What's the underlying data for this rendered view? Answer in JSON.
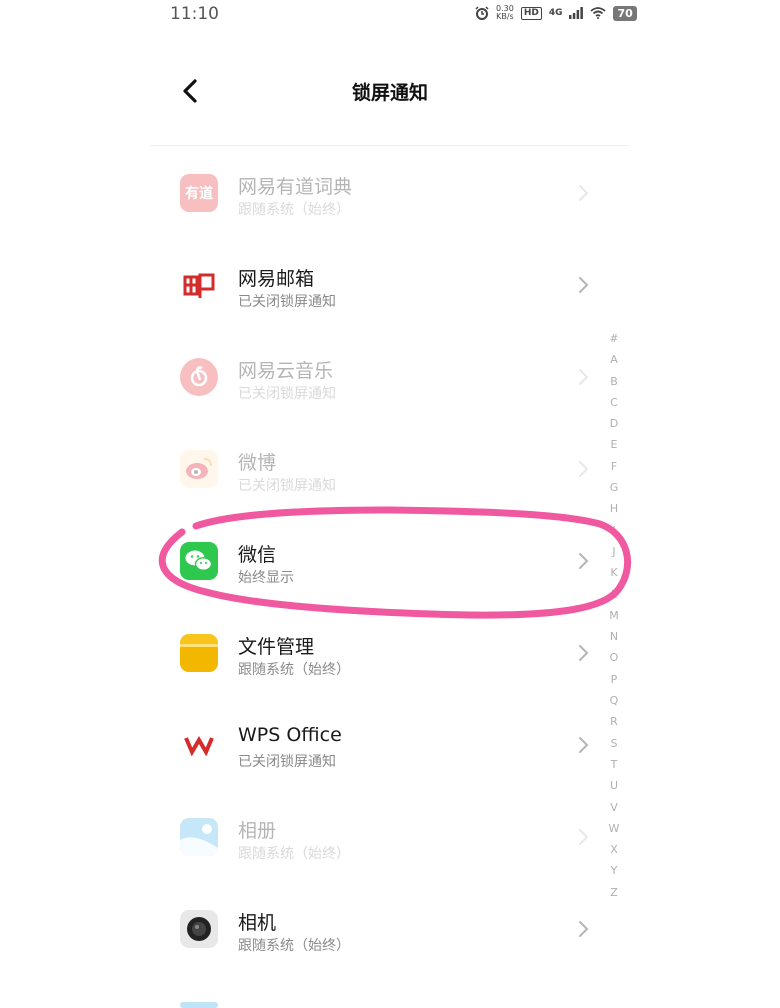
{
  "status_bar": {
    "time": "11:10",
    "net_speed_value": "0.30",
    "net_speed_unit": "KB/s",
    "hd_label": "HD",
    "network": "4G",
    "battery": "70"
  },
  "header": {
    "title": "锁屏通知"
  },
  "apps": [
    {
      "name": "网易有道词典",
      "status": "跟随系统（始终）",
      "icon": "youdao-dict-icon",
      "icon_text": "有道",
      "dimmed": true
    },
    {
      "name": "网易邮箱",
      "status": "已关闭锁屏通知",
      "icon": "netease-mail-icon",
      "icon_text": "",
      "dimmed": false
    },
    {
      "name": "网易云音乐",
      "status": "已关闭锁屏通知",
      "icon": "netease-music-icon",
      "icon_text": "",
      "dimmed": true
    },
    {
      "name": "微博",
      "status": "已关闭锁屏通知",
      "icon": "weibo-icon",
      "icon_text": "",
      "dimmed": true
    },
    {
      "name": "微信",
      "status": "始终显示",
      "icon": "wechat-icon",
      "icon_text": "",
      "dimmed": false
    },
    {
      "name": "文件管理",
      "status": "跟随系统（始终）",
      "icon": "file-manager-icon",
      "icon_text": "",
      "dimmed": false
    },
    {
      "name": "WPS Office",
      "status": "已关闭锁屏通知",
      "icon": "wps-office-icon",
      "icon_text": "",
      "dimmed": false
    },
    {
      "name": "相册",
      "status": "跟随系统（始终）",
      "icon": "gallery-icon",
      "icon_text": "",
      "dimmed": true
    },
    {
      "name": "相机",
      "status": "跟随系统（始终）",
      "icon": "camera-icon",
      "icon_text": "",
      "dimmed": false
    }
  ],
  "alphabet_index": [
    "#",
    "A",
    "B",
    "C",
    "D",
    "E",
    "F",
    "G",
    "H",
    "I",
    "J",
    "K",
    "L",
    "M",
    "N",
    "O",
    "P",
    "Q",
    "R",
    "S",
    "T",
    "U",
    "V",
    "W",
    "X",
    "Y",
    "Z"
  ],
  "colors": {
    "annotation": "#f0599f",
    "wechat": "#2dc84d",
    "mail_red": "#d42b2b",
    "youdao_red": "#e83a3a",
    "file_yellow": "#f7c51c"
  }
}
